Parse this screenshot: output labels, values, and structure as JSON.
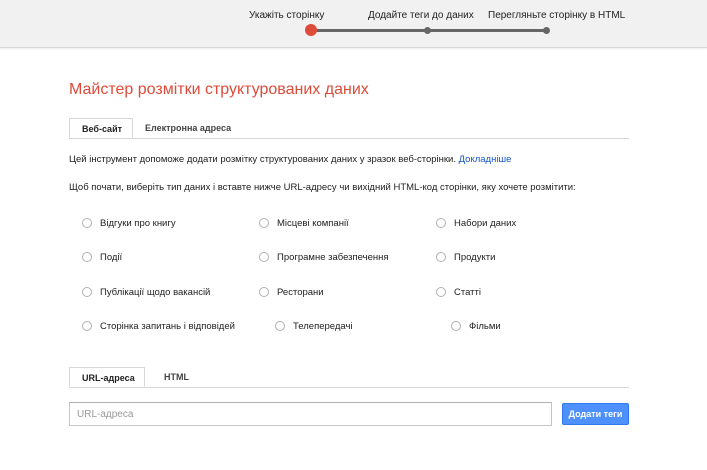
{
  "wizard": {
    "steps": [
      {
        "label": "Укажіть сторінку",
        "active": true
      },
      {
        "label": "Додайте теги до даних",
        "active": false
      },
      {
        "label": "Перегляньте сторінку в HTML",
        "active": false
      }
    ]
  },
  "page": {
    "title": "Майстер розмітки структурованих даних"
  },
  "source_tabs": [
    "Веб-сайт",
    "Електронна адреса"
  ],
  "intro": {
    "text": "Цей інструмент допоможе додати розмітку структурованих даних у зразок веб-сторінки.",
    "link": "Докладніше"
  },
  "instruction": "Щоб почати, виберіть тип даних і вставте нижче URL-адресу чи вихідний HTML-код сторінки, яку хочете розмітити:",
  "data_types": [
    "Відгуки про книгу",
    "Місцеві компанії",
    "Набори даних",
    "Події",
    "Програмне забезпечення",
    "Продукти",
    "Публікації щодо вакансій",
    "Ресторани",
    "Статті",
    "Сторінка запитань і відповідей",
    "Телепередачі",
    "Фільми"
  ],
  "input_tabs": [
    "URL-адреса",
    "HTML"
  ],
  "url_input": {
    "placeholder": "URL-адреса",
    "value": ""
  },
  "submit": {
    "label": "Додати теги"
  },
  "colors": {
    "accent": "#dd4b39",
    "link": "#1155cc",
    "button": "#4d90fe"
  }
}
